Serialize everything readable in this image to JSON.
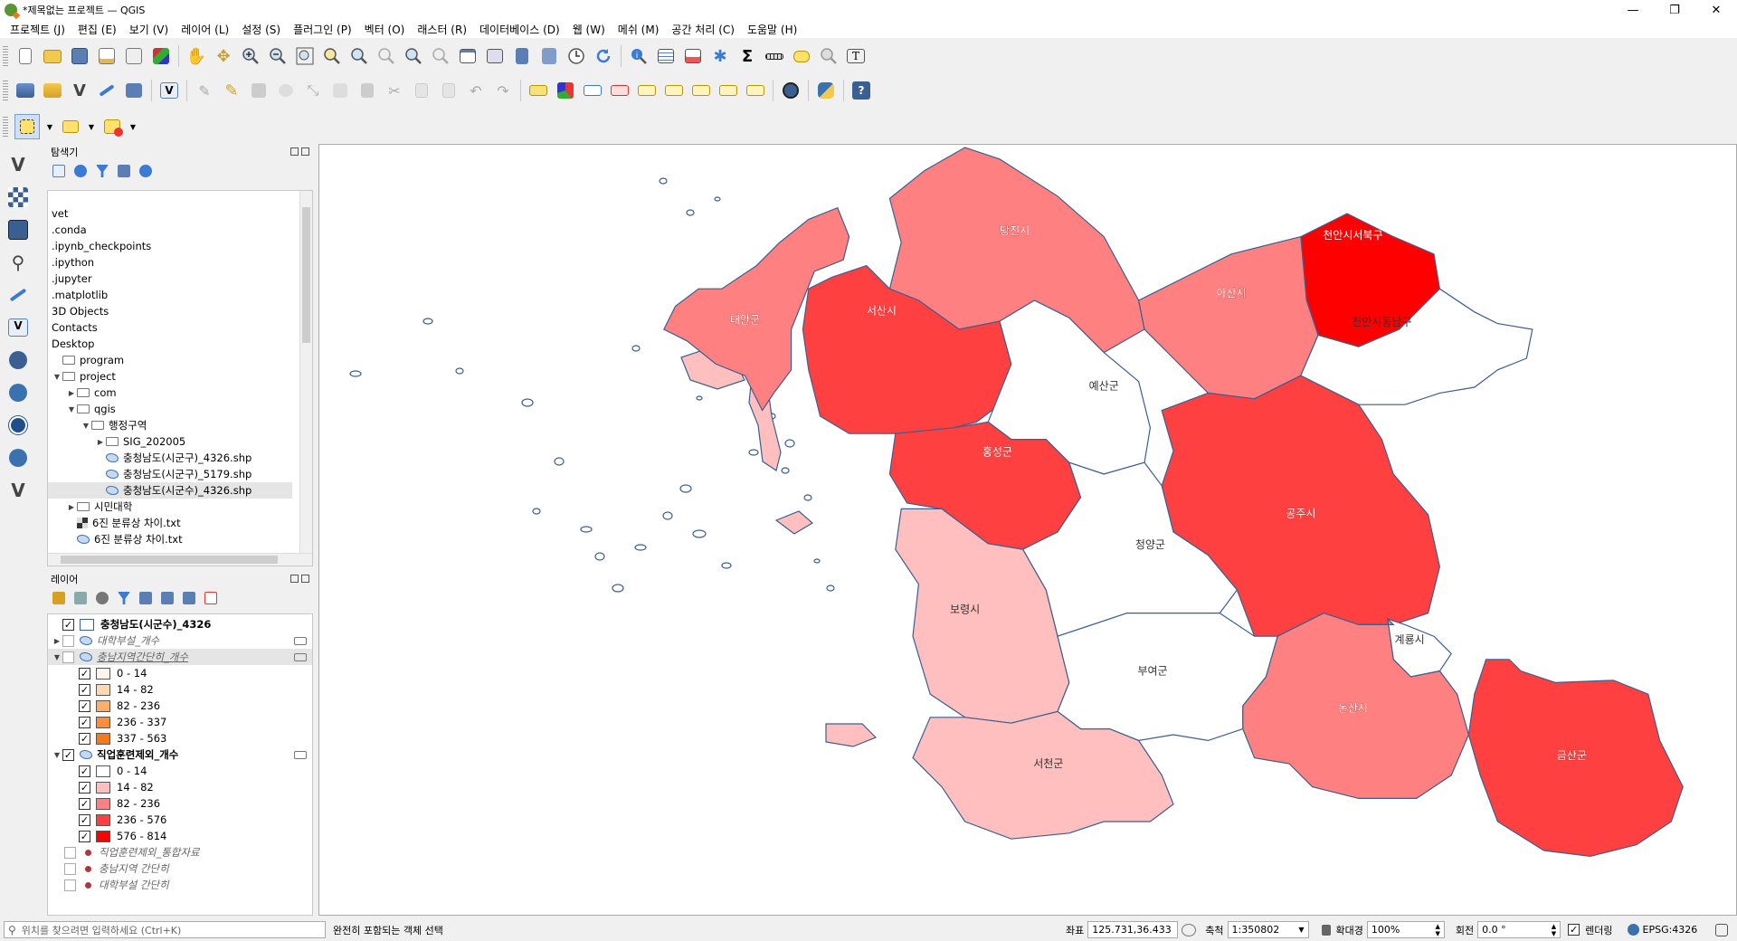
{
  "window": {
    "title": "*제목없는 프로젝트 — QGIS",
    "minimize": "—",
    "restore": "❐",
    "close": "✕"
  },
  "menu": [
    "프로젝트 (J)",
    "편집 (E)",
    "보기 (V)",
    "레이어 (L)",
    "설정 (S)",
    "플러그인 (P)",
    "벡터 (O)",
    "래스터 (R)",
    "데이터베이스 (D)",
    "웹 (W)",
    "메쉬 (M)",
    "공간 처리 (C)",
    "도움말 (H)"
  ],
  "browser": {
    "title": "탐색기",
    "items": [
      {
        "label": "vet",
        "indent": 0,
        "icon": "none",
        "arrow": ""
      },
      {
        "label": ".conda",
        "indent": 0,
        "icon": "none",
        "arrow": ""
      },
      {
        "label": ".ipynb_checkpoints",
        "indent": 0,
        "icon": "none",
        "arrow": ""
      },
      {
        "label": ".ipython",
        "indent": 0,
        "icon": "none",
        "arrow": ""
      },
      {
        "label": ".jupyter",
        "indent": 0,
        "icon": "none",
        "arrow": ""
      },
      {
        "label": ".matplotlib",
        "indent": 0,
        "icon": "none",
        "arrow": ""
      },
      {
        "label": "3D Objects",
        "indent": 0,
        "icon": "none",
        "arrow": ""
      },
      {
        "label": "Contacts",
        "indent": 0,
        "icon": "none",
        "arrow": ""
      },
      {
        "label": "Desktop",
        "indent": 0,
        "icon": "none",
        "arrow": ""
      },
      {
        "label": "program",
        "indent": 0,
        "icon": "folder",
        "arrow": ""
      },
      {
        "label": "project",
        "indent": 0,
        "icon": "folder",
        "arrow": "▼"
      },
      {
        "label": "com",
        "indent": 1,
        "icon": "folder",
        "arrow": "▶"
      },
      {
        "label": "qgis",
        "indent": 1,
        "icon": "folder",
        "arrow": "▼"
      },
      {
        "label": "행정구역",
        "indent": 2,
        "icon": "folder",
        "arrow": "▼"
      },
      {
        "label": "SIG_202005",
        "indent": 3,
        "icon": "folder",
        "arrow": "▶"
      },
      {
        "label": "충청남도(시군구)_4326.shp",
        "indent": 3,
        "icon": "layer",
        "arrow": ""
      },
      {
        "label": "충청남도(시군구)_5179.shp",
        "indent": 3,
        "icon": "layer",
        "arrow": ""
      },
      {
        "label": "충청남도(시군수)_4326.shp",
        "indent": 3,
        "icon": "layer",
        "arrow": "",
        "selected": true
      },
      {
        "label": "시민대학",
        "indent": 1,
        "icon": "folder",
        "arrow": "▶"
      },
      {
        "label": "6진 분류상 차이.txt",
        "indent": 1,
        "icon": "raster",
        "arrow": ""
      },
      {
        "label": "6진 분류상 차이.txt",
        "indent": 1,
        "icon": "layer",
        "arrow": ""
      }
    ]
  },
  "layers": {
    "title": "레이어",
    "items": [
      {
        "type": "layer",
        "label": "충청남도(시군수)_4326",
        "checked": true,
        "bold": true,
        "arrow": "",
        "swatch": "#ffffff"
      },
      {
        "type": "layer",
        "label": "대학부설_개수",
        "checked": false,
        "italic": true,
        "arrow": "▶",
        "eye": true
      },
      {
        "type": "layer",
        "label": "충남지역간단히_개수",
        "checked": false,
        "italic": true,
        "arrow": "▼",
        "eye": true,
        "underline": true
      },
      {
        "type": "class",
        "label": "0 - 14",
        "swatch": "#fff5eb"
      },
      {
        "type": "class",
        "label": "14 - 82",
        "swatch": "#fdd8b3"
      },
      {
        "type": "class",
        "label": "82 - 236",
        "swatch": "#fdae6b"
      },
      {
        "type": "class",
        "label": "236 - 337",
        "swatch": "#fd8d3c"
      },
      {
        "type": "class",
        "label": "337 - 563",
        "swatch": "#f07a1c"
      },
      {
        "type": "layer",
        "label": "직업훈련제외_개수",
        "checked": true,
        "bold": true,
        "arrow": "▼",
        "eye": true
      },
      {
        "type": "class",
        "label": "0 - 14",
        "swatch": "#ffffff"
      },
      {
        "type": "class",
        "label": "14 - 82",
        "swatch": "#ffbfbf"
      },
      {
        "type": "class",
        "label": "82 - 236",
        "swatch": "#ff8080"
      },
      {
        "type": "class",
        "label": "236 - 576",
        "swatch": "#ff4040"
      },
      {
        "type": "class",
        "label": "576 - 814",
        "swatch": "#ff0000"
      },
      {
        "type": "point",
        "label": "직업훈련제외_통합자료",
        "checked": false
      },
      {
        "type": "point",
        "label": "충남지역 간단히",
        "checked": false
      },
      {
        "type": "point",
        "label": "대학부설 간단히",
        "checked": false
      }
    ]
  },
  "map": {
    "regions": [
      {
        "label": "당진시",
        "color": "#ff8080"
      },
      {
        "label": "천안시서북구",
        "color": "#ff0000"
      },
      {
        "label": "아산시",
        "color": "#ff8080"
      },
      {
        "label": "천안시동남구",
        "color": "#ffffff"
      },
      {
        "label": "태안군",
        "color": "#ff8080"
      },
      {
        "label": "서산시",
        "color": "#ff4040"
      },
      {
        "label": "예산군",
        "color": "#ffffff"
      },
      {
        "label": "홍성군",
        "color": "#ff4040"
      },
      {
        "label": "공주시",
        "color": "#ff4040"
      },
      {
        "label": "청양군",
        "color": "#ffffff"
      },
      {
        "label": "보령시",
        "color": "#ffbfbf"
      },
      {
        "label": "계룡시",
        "color": "#ffffff"
      },
      {
        "label": "부여군",
        "color": "#ffffff"
      },
      {
        "label": "논산시",
        "color": "#ff8080"
      },
      {
        "label": "금산군",
        "color": "#ff4040"
      },
      {
        "label": "서천군",
        "color": "#ffbfbf"
      }
    ],
    "border_color": "#3a5f91"
  },
  "status": {
    "locator_placeholder": "위치를 찾으려면 입력하세요 (Ctrl+K)",
    "message": "완전히 포함되는 객체 선택",
    "coord_label": "좌표",
    "coord_value": "125.731,36.433",
    "scale_label": "축척",
    "scale_value": "1:350802",
    "mag_label": "확대경",
    "mag_value": "100%",
    "rot_label": "회전",
    "rot_value": "0.0 °",
    "render_label": "렌더링",
    "crs": "EPSG:4326"
  }
}
